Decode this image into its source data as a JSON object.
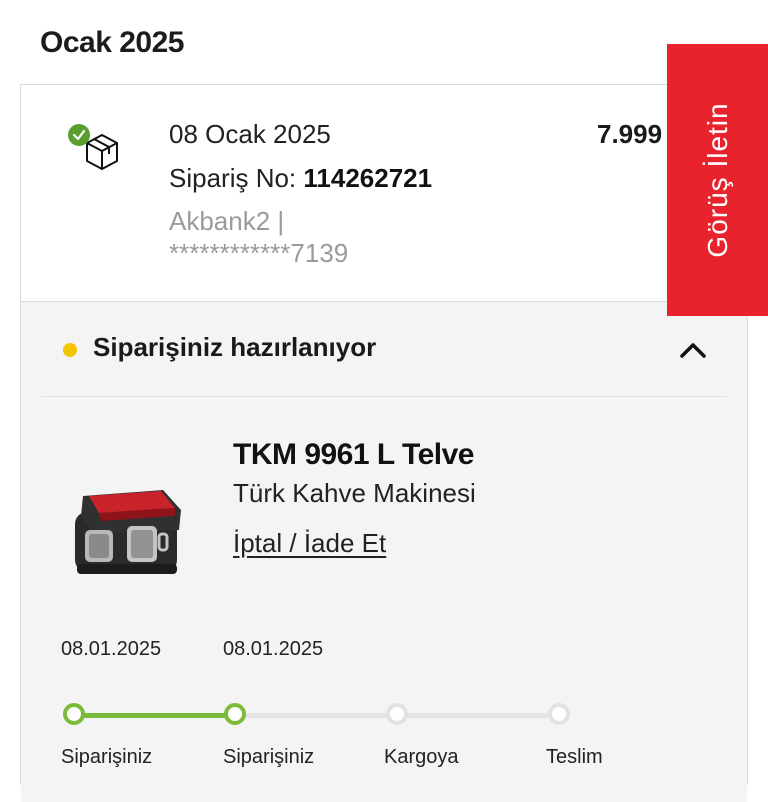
{
  "month_title": "Ocak 2025",
  "order": {
    "date": "08 Ocak 2025",
    "order_no_label": "Sipariş No: ",
    "order_no": "114262721",
    "payment_line1": "Akbank2 |",
    "payment_line2": "************7139",
    "price": "7.999",
    "status_icon": "package-delivered-check-icon"
  },
  "status": {
    "text": "Siparişiniz hazırlanıyor",
    "dot_color": "#f2c500",
    "toggle_icon": "chevron-up-icon"
  },
  "product": {
    "name": "TKM 9961 L Telve",
    "subtitle": "Türk Kahve Makinesi",
    "cancel_link": "İptal / İade Et",
    "image_icon": "coffee-machine-image"
  },
  "tracking": {
    "accent_color": "#7cba3a",
    "steps": [
      {
        "label": "Siparişiniz",
        "date": "08.01.2025",
        "done": true
      },
      {
        "label": "Siparişiniz",
        "date": "08.01.2025",
        "done": true
      },
      {
        "label": "Kargoya",
        "date": "",
        "done": false
      },
      {
        "label": "Teslim",
        "date": "",
        "done": false
      }
    ]
  },
  "feedback": {
    "label": "Görüş İletin",
    "color": "#e8232d"
  }
}
